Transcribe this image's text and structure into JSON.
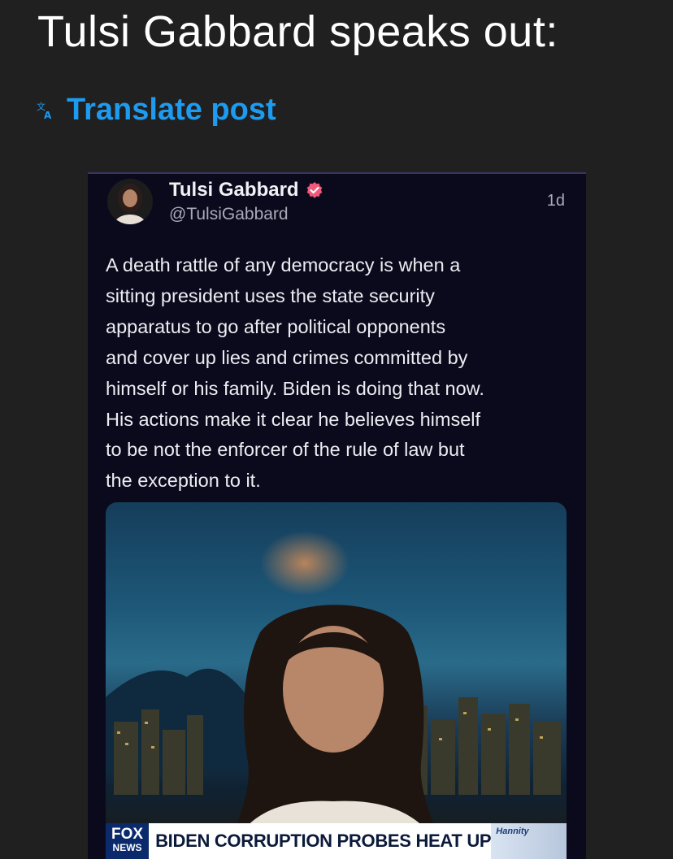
{
  "post": {
    "title": "Tulsi Gabbard speaks out:",
    "translate_label": "Translate post",
    "translate_icon": "translate-icon"
  },
  "embedded_tweet": {
    "author_name": "Tulsi Gabbard",
    "handle": "@TulsiGabbard",
    "timestamp": "1d",
    "verified_icon": "verified-badge-icon",
    "body_lines": [
      "A death rattle of any democracy is when a",
      "sitting president uses the state security",
      "apparatus to go after political opponents",
      "and cover up lies and crimes committed by",
      "himself or his family. Biden is doing that now.",
      "His actions make it clear he believes himself",
      "to be not the enforcer of the rule of law but",
      "the exception to it."
    ],
    "media": {
      "network_logo_top": "FOX",
      "network_logo_bottom": "NEWS",
      "headline": "BIDEN CORRUPTION PROBES HEAT UP",
      "show_name": "Hannity"
    }
  },
  "colors": {
    "background": "#202020",
    "link": "#1d9bf0",
    "embed_background": "#0b0a1c",
    "verified": "#f2587a"
  }
}
